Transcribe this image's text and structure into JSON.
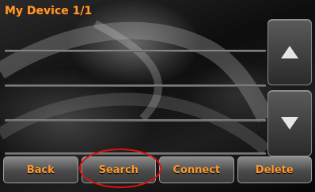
{
  "header": {
    "title": "My Device  1/1"
  },
  "list": {
    "rows": [
      "",
      "",
      "",
      ""
    ]
  },
  "scroll": {
    "up_icon": "up-arrow",
    "down_icon": "down-arrow"
  },
  "toolbar": {
    "back_label": "Back",
    "search_label": "Search",
    "connect_label": "Connect",
    "delete_label": "Delete"
  },
  "colors": {
    "accent": "#ff9a2e",
    "highlight": "#e01010"
  }
}
